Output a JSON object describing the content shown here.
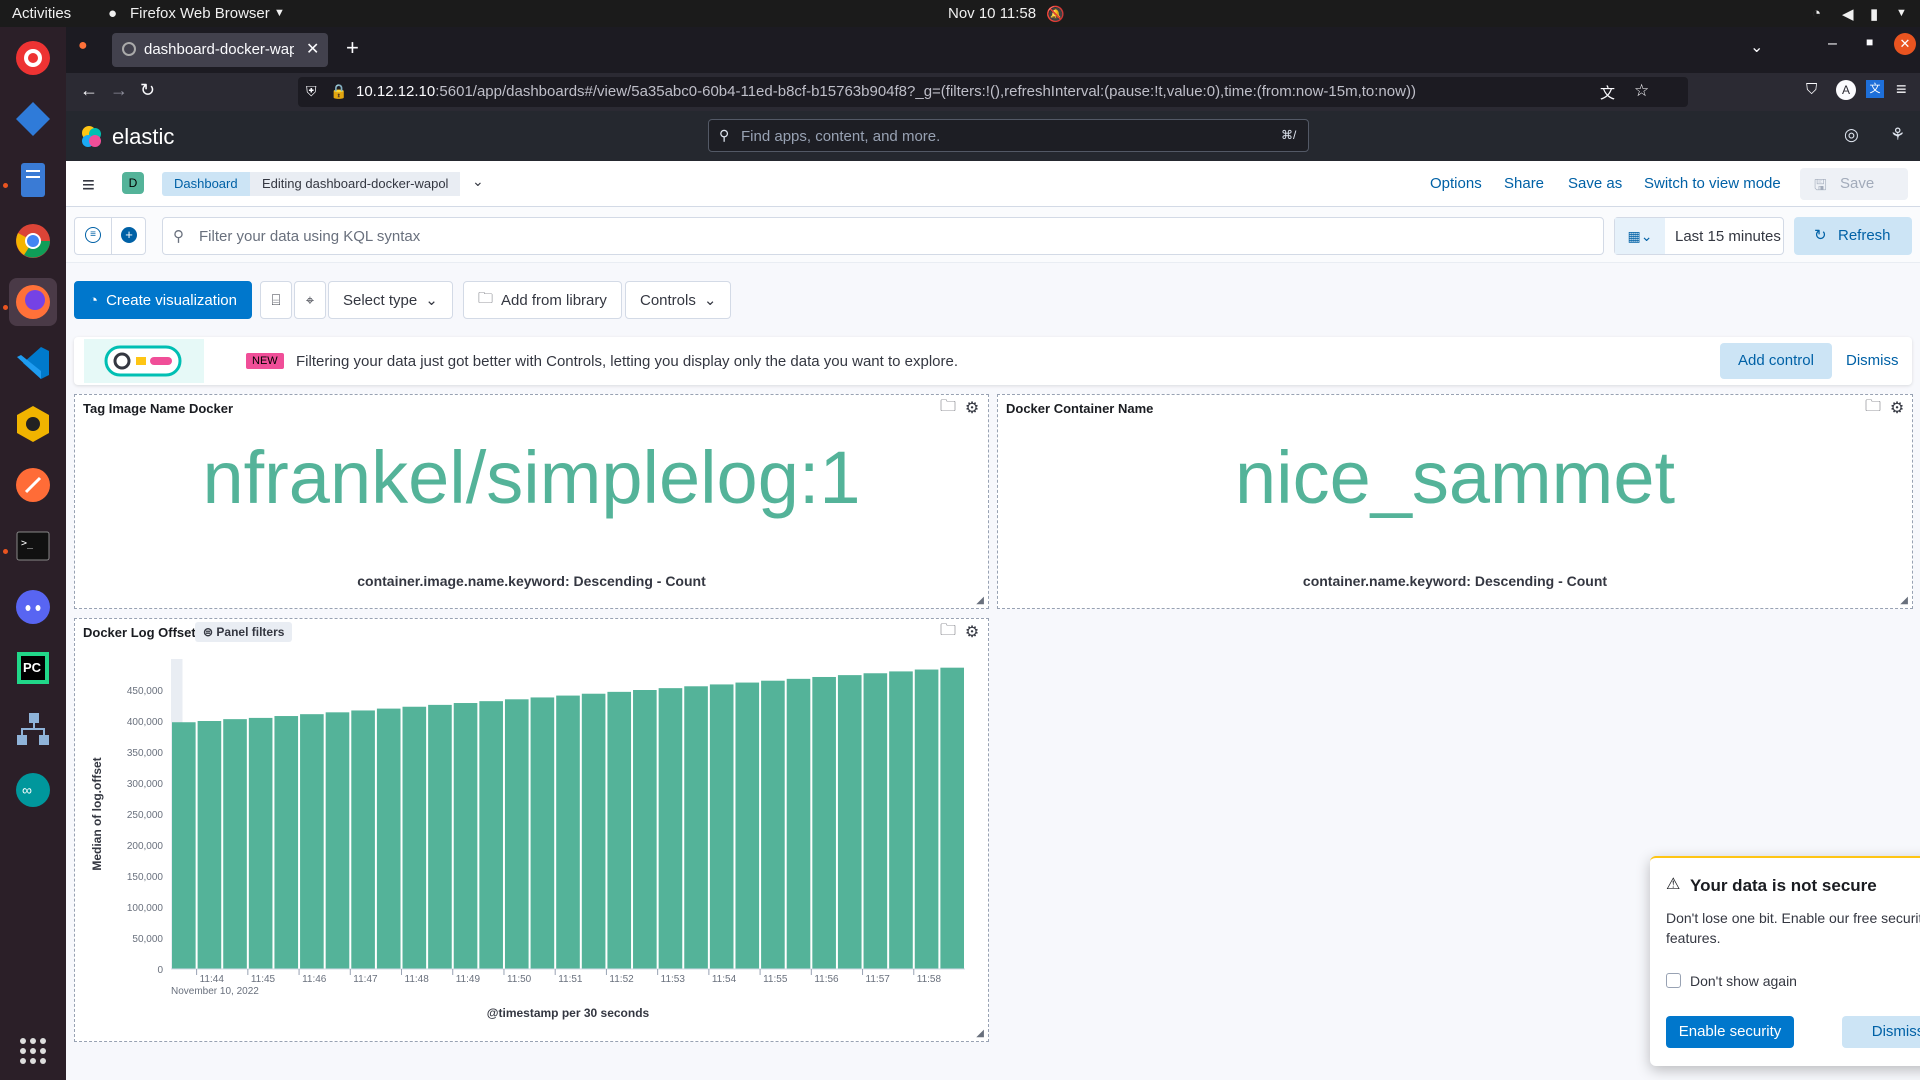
{
  "system": {
    "activities": "Activities",
    "app_menu": "Firefox Web Browser",
    "clock": "Nov 10  11:58"
  },
  "browser": {
    "tab_title": "dashboard-docker-wapol",
    "url_host": "10.12.12.10",
    "url_rest": ":5601/app/dashboards#/view/5a35abc0-60b4-11ed-b8cf-b15763b904f8?_g=(filters:!(),refreshInterval:(pause:!t,value:0),time:(from:now-15m,to:now))"
  },
  "kibana": {
    "brand": "elastic",
    "search_placeholder": "Find apps, content, and more.",
    "search_shortcut": "⌘/",
    "space_letter": "D",
    "breadcrumb_root": "Dashboard",
    "breadcrumb_current": "Editing dashboard-docker-wapol",
    "top_links": {
      "options": "Options",
      "share": "Share",
      "save_as": "Save as",
      "switch": "Switch to view mode",
      "save": "Save"
    },
    "kql_placeholder": "Filter your data using KQL syntax",
    "time_range": "Last 15 minutes",
    "refresh": "Refresh"
  },
  "toolbar": {
    "create_viz": "Create visualization",
    "select_type": "Select type",
    "add_from_library": "Add from library",
    "controls": "Controls"
  },
  "callout": {
    "badge": "NEW",
    "text": "Filtering your data just got better with Controls, letting you display only the data you want to explore.",
    "add_control": "Add control",
    "dismiss": "Dismiss"
  },
  "panels": {
    "image": {
      "title": "Tag Image Name Docker",
      "value": "nfrankel/simplelog:1",
      "label": "container.image.name.keyword: Descending - Count"
    },
    "container": {
      "title": "Docker Container Name",
      "value": "nice_sammet",
      "label": "container.name.keyword: Descending - Count"
    },
    "offset": {
      "title": "Docker Log Offset",
      "badge": "Panel filters"
    }
  },
  "chart_data": {
    "type": "bar",
    "ylabel": "Median of log.offset",
    "xlabel": "@timestamp per 30 seconds",
    "date_label": "November 10, 2022",
    "ylim": [
      0,
      500000
    ],
    "y_ticks": [
      "0",
      "50,000",
      "100,000",
      "150,000",
      "200,000",
      "250,000",
      "300,000",
      "350,000",
      "400,000",
      "450,000"
    ],
    "x_ticks": [
      "11:44",
      "11:45",
      "11:46",
      "11:47",
      "11:48",
      "11:49",
      "11:50",
      "11:51",
      "11:52",
      "11:53",
      "11:54",
      "11:55",
      "11:56",
      "11:57",
      "11:58"
    ],
    "x": [
      "11:43:30",
      "11:44:00",
      "11:44:30",
      "11:45:00",
      "11:45:30",
      "11:46:00",
      "11:46:30",
      "11:47:00",
      "11:47:30",
      "11:48:00",
      "11:48:30",
      "11:49:00",
      "11:49:30",
      "11:50:00",
      "11:50:30",
      "11:51:00",
      "11:51:30",
      "11:52:00",
      "11:52:30",
      "11:53:00",
      "11:53:30",
      "11:54:00",
      "11:54:30",
      "11:55:00",
      "11:55:30",
      "11:56:00",
      "11:56:30",
      "11:57:00",
      "11:57:30",
      "11:58:00",
      "11:58:30"
    ],
    "values": [
      398000,
      400000,
      403000,
      405000,
      408000,
      411000,
      414000,
      417000,
      420000,
      423000,
      426000,
      429000,
      432000,
      435000,
      438000,
      441000,
      444000,
      447000,
      450000,
      453000,
      456000,
      459000,
      462000,
      465000,
      468000,
      471000,
      474000,
      477000,
      480000,
      483000,
      486000
    ],
    "color": "#54b399"
  },
  "toast": {
    "title": "Your data is not secure",
    "body": "Don't lose one bit. Enable our free security features.",
    "checkbox": "Don't show again",
    "enable": "Enable security",
    "dismiss": "Dismiss"
  }
}
